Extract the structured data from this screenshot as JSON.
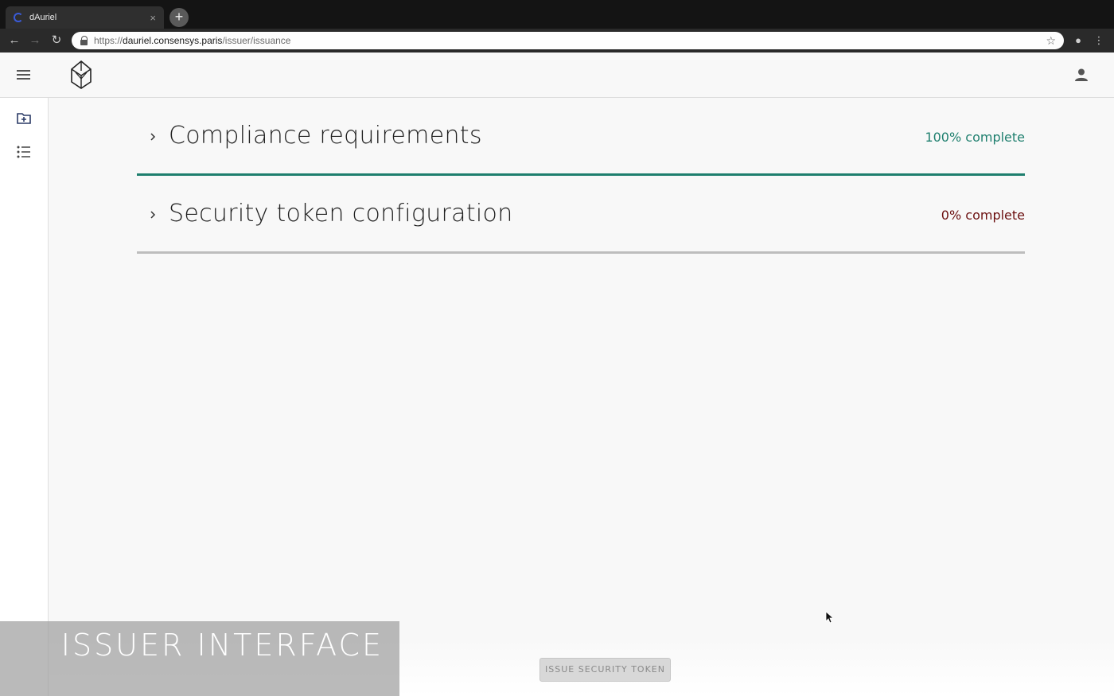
{
  "browser": {
    "tab_title": "dAuriel",
    "tab_close": "×",
    "new_tab": "+",
    "url_scheme": "https://",
    "url_host": "dauriel.consensys.paris",
    "url_path": "/issuer/issuance"
  },
  "sections": [
    {
      "title": "Compliance requirements",
      "status": "100% complete",
      "progress": 100,
      "status_color": "#1e7f6e"
    },
    {
      "title": "Security token configuration",
      "status": "0% complete",
      "progress": 0,
      "status_color": "#6b0f0f"
    }
  ],
  "actions": {
    "issue_label": "ISSUE SECURITY TOKEN"
  },
  "overlay": {
    "caption": "ISSUER INTERFACE"
  },
  "icons": {
    "menu": "hamburger-menu-icon",
    "logo": "dauriel-logo",
    "user": "user-account-icon",
    "new_issuance": "folder-add-icon",
    "list": "list-icon"
  },
  "colors": {
    "accent": "#1e7f6e",
    "incomplete": "#6b0f0f"
  }
}
